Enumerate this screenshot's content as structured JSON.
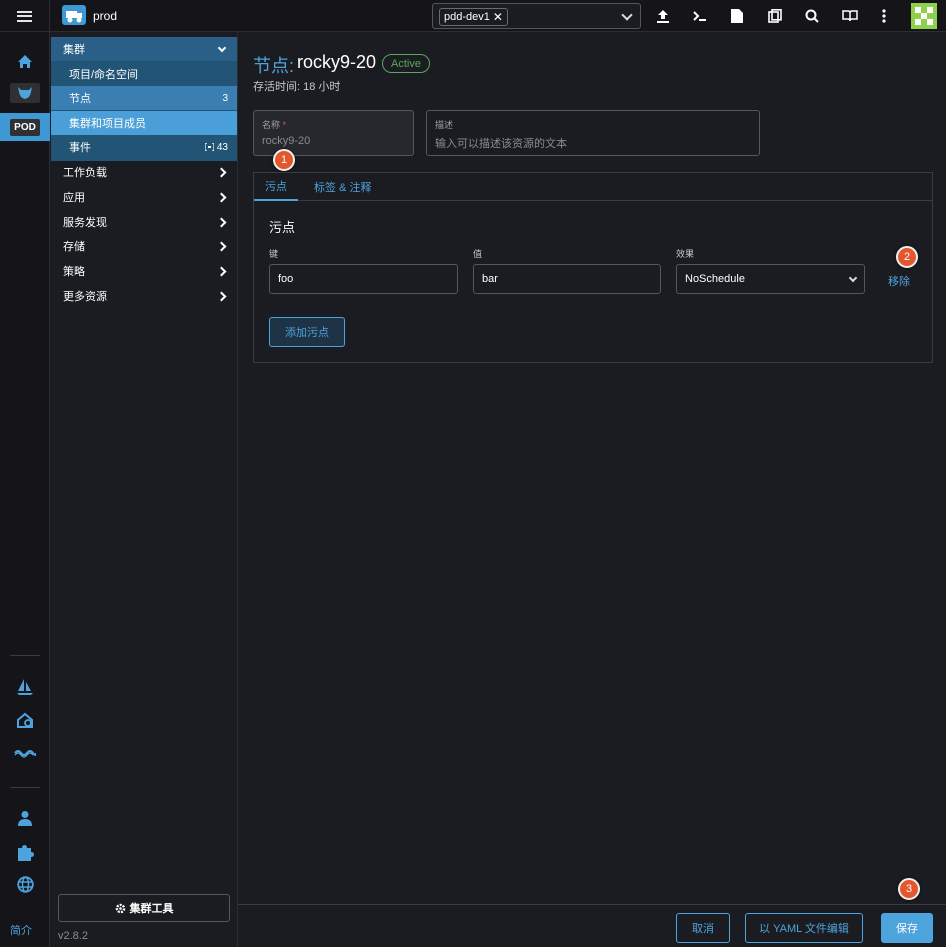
{
  "topbar": {
    "cluster_name": "prod",
    "namespace_chip": "pdd-dev1",
    "namespace_chip_remove": "✕"
  },
  "rail": {
    "pod_badge": "POD",
    "bottom_text": "简介"
  },
  "sidenav": {
    "group_label": "集群",
    "sub_items": [
      {
        "label": "项目/命名空间",
        "count": ""
      },
      {
        "label": "节点",
        "count": "3"
      },
      {
        "label": "集群和项目成员",
        "count": ""
      },
      {
        "label": "事件",
        "count": "43"
      }
    ],
    "top_items": [
      {
        "label": "工作负载"
      },
      {
        "label": "应用"
      },
      {
        "label": "服务发现"
      },
      {
        "label": "存储"
      },
      {
        "label": "策略"
      },
      {
        "label": "更多资源"
      }
    ],
    "tools_label": "集群工具",
    "version": "v2.8.2"
  },
  "page": {
    "title_prefix": "节点:",
    "title_name": "rocky9-20",
    "state": "Active",
    "age": "存活时间: 18 小时"
  },
  "form": {
    "name_label": "名称",
    "name_required": "*",
    "name_value": "rocky9-20",
    "desc_label": "描述",
    "desc_placeholder": "输入可以描述该资源的文本"
  },
  "tabs": [
    {
      "label": "污点",
      "active": true
    },
    {
      "label": "标签 & 注释",
      "active": false
    }
  ],
  "taints": {
    "section_title": "污点",
    "key_label": "键",
    "value_label": "值",
    "effect_label": "效果",
    "rows": [
      {
        "key": "foo",
        "value": "bar",
        "effect": "NoSchedule"
      }
    ],
    "remove_label": "移除",
    "add_label": "添加污点"
  },
  "footer": {
    "cancel": "取消",
    "edit_yaml": "以 YAML 文件编辑",
    "save": "保存"
  },
  "markers": [
    "1",
    "2",
    "3"
  ],
  "colors": {
    "accent": "#4da3dc",
    "state_active": "#5aa85a",
    "marker": "#e4572e",
    "background": "#1b1c21"
  }
}
